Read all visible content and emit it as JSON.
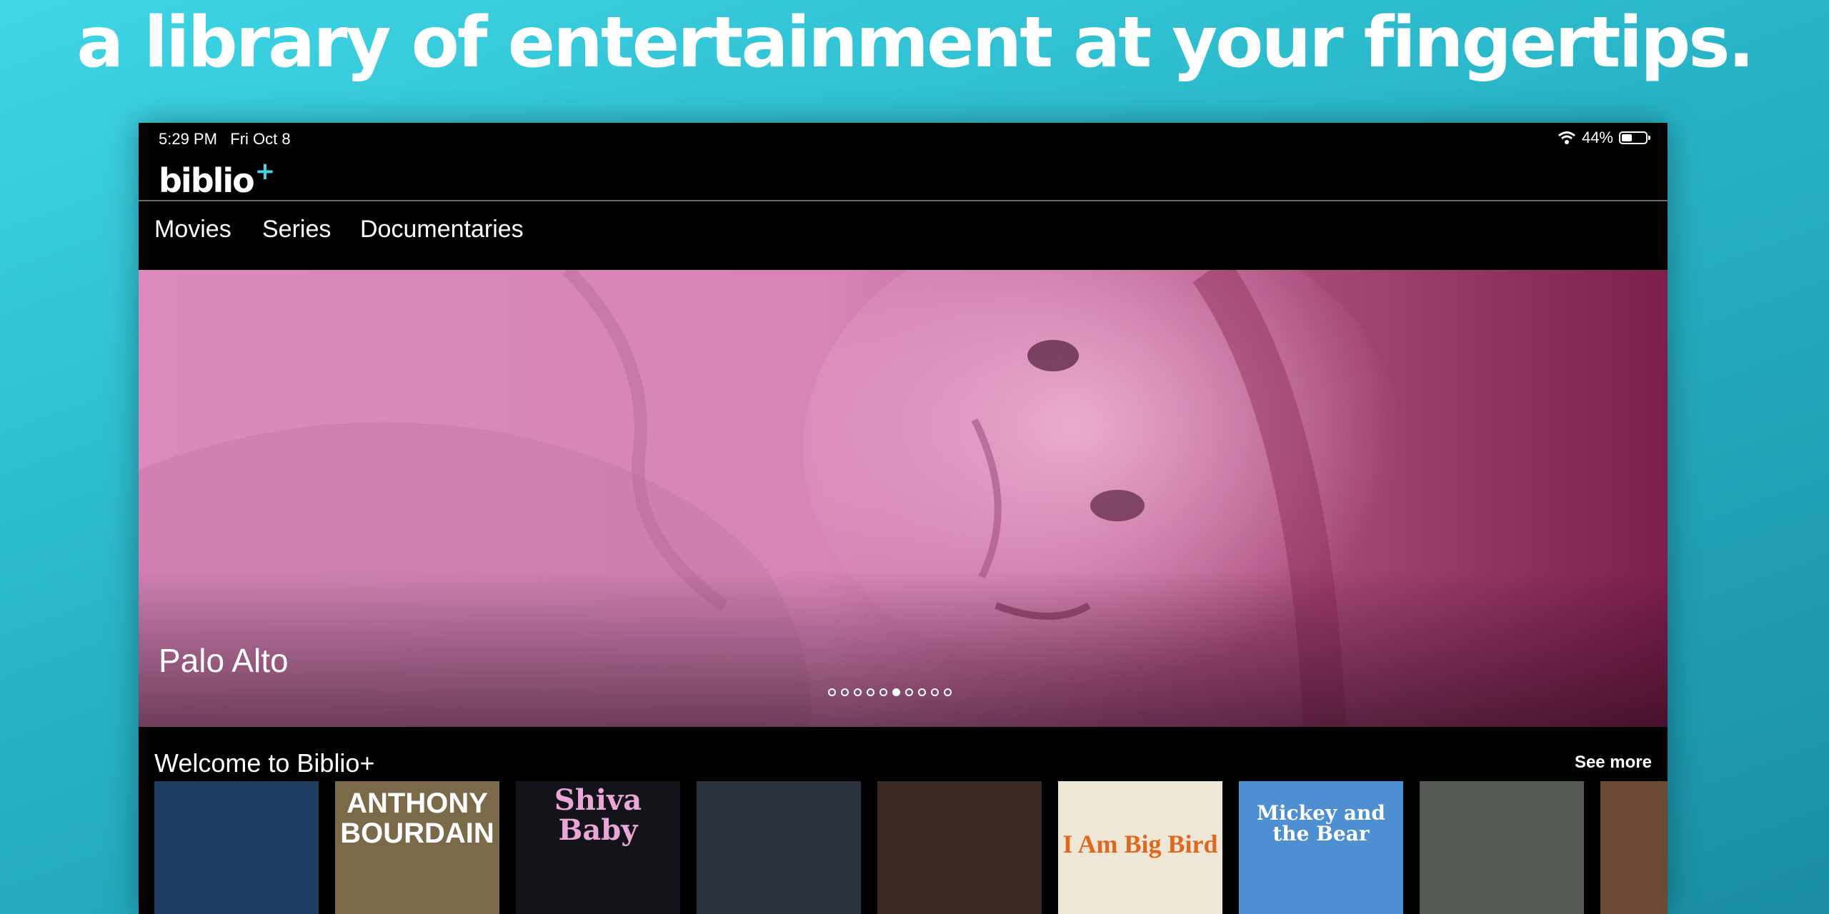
{
  "headline": "a library of entertainment at your fingertips.",
  "status_bar": {
    "time": "5:29 PM",
    "date": "Fri Oct 8",
    "battery": "44%",
    "battery_level": 0.44
  },
  "app": {
    "logo": "biblio",
    "logo_plus": "+",
    "accent_color": "#3fd6e6"
  },
  "nav": {
    "tabs": [
      {
        "label": "Movies"
      },
      {
        "label": "Series"
      },
      {
        "label": "Documentaries"
      }
    ]
  },
  "hero": {
    "title": "Palo Alto",
    "carousel_count": 10,
    "carousel_active_index": 5
  },
  "row": {
    "title": "Welcome to Biblio+",
    "see_more": "See more",
    "posters": [
      {
        "text": "",
        "bg": "#1f3f62"
      },
      {
        "text": "ANTHONY BOURDAIN",
        "bg": "#7a6a4a"
      },
      {
        "text": "Shiva Baby",
        "bg": "#15131a"
      },
      {
        "text": "",
        "bg": "#2b3340"
      },
      {
        "text": "",
        "bg": "#3b2a22"
      },
      {
        "text": "I Am Big Bird",
        "bg": "#efe7d5"
      },
      {
        "text": "Mickey and the Bear",
        "bg": "#4d8fd0"
      },
      {
        "text": "",
        "bg": "#565a55"
      },
      {
        "text": "",
        "bg": "#6b4a33"
      }
    ]
  }
}
